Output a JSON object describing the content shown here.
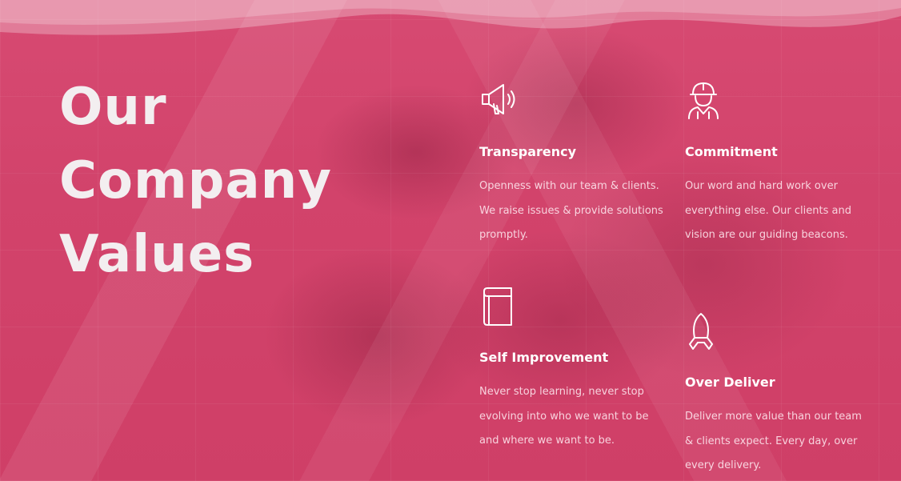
{
  "headline": {
    "line1": "Our",
    "line2": "Company",
    "line3": "Values"
  },
  "values": [
    {
      "title": "Transparency",
      "icon": "megaphone-icon",
      "text": "Openness with our team & clients. We raise issues & provide solutions promptly."
    },
    {
      "title": "Commitment",
      "icon": "worker-hardhat-icon",
      "text": "Our word and hard work over everything else. Our clients and vision are our guiding beacons."
    },
    {
      "title": "Self Improvement",
      "icon": "book-icon",
      "text": "Never stop learning, never stop evolving into who we want to be and where we want to be."
    },
    {
      "title": "Over Deliver",
      "icon": "rocket-icon",
      "text": "Deliver more value than our team & clients expect. Every day, over every delivery."
    }
  ],
  "colors": {
    "overlay": "#d2436b",
    "heading": "#f3eef0",
    "text": "#ffecf2"
  }
}
